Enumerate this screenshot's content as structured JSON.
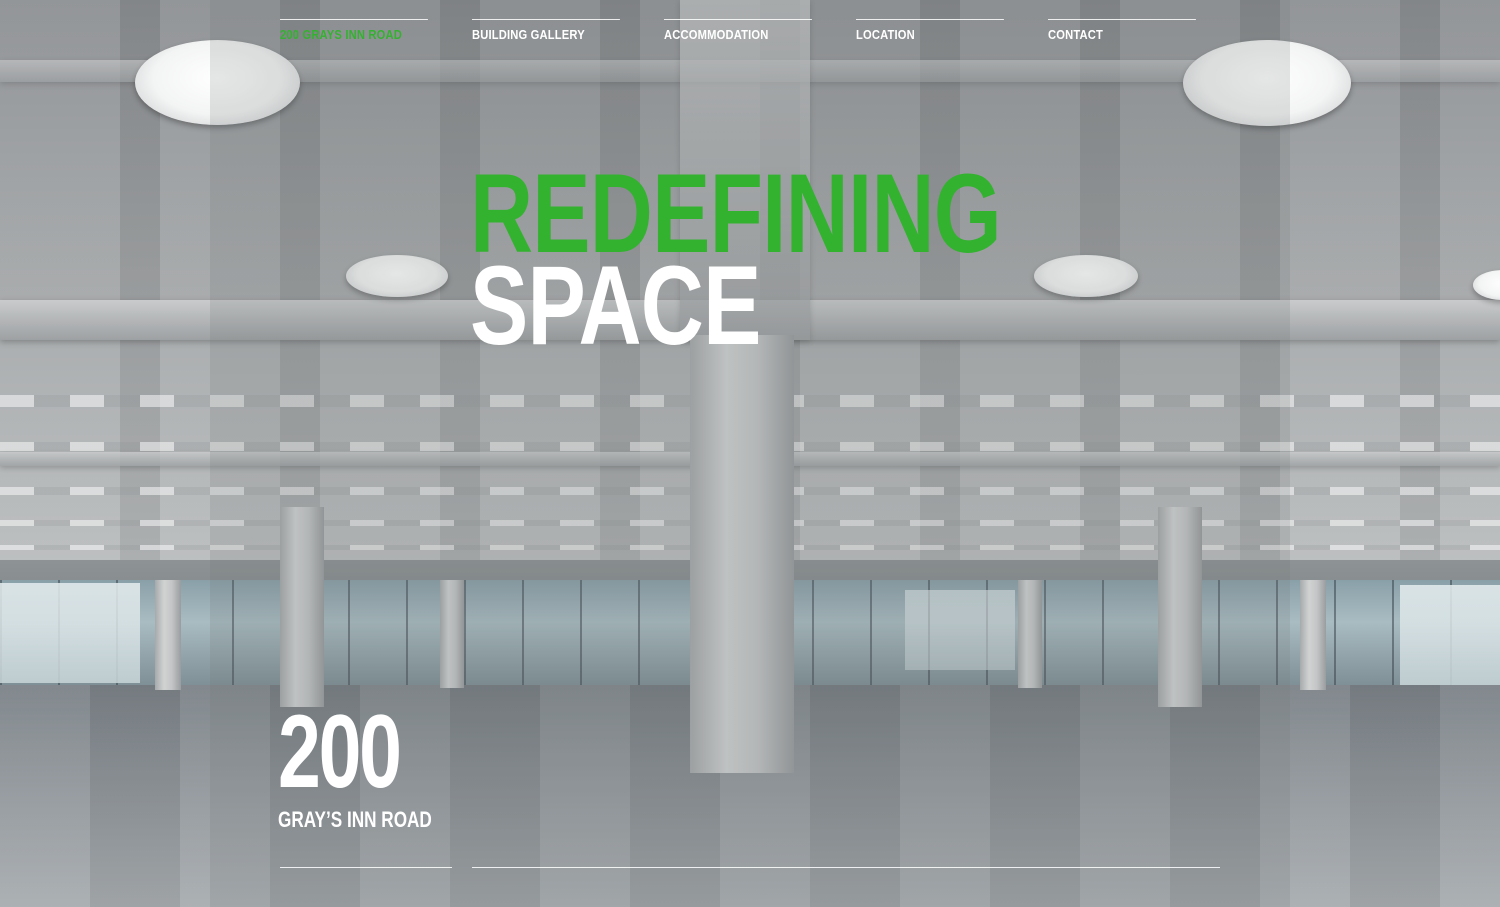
{
  "nav": {
    "items": [
      {
        "label": "200 GRAYS INN ROAD",
        "active": true
      },
      {
        "label": "BUILDING GALLERY",
        "active": false
      },
      {
        "label": "ACCOMMODATION",
        "active": false
      },
      {
        "label": "LOCATION",
        "active": false
      },
      {
        "label": "CONTACT",
        "active": false
      }
    ]
  },
  "hero": {
    "line1": "REDEFINING",
    "line2": "SPACE"
  },
  "logo": {
    "number": "200",
    "subtitle": "GRAY’S INN ROAD"
  },
  "colors": {
    "accent_green": "#33b22f",
    "text_white": "#ffffff"
  }
}
